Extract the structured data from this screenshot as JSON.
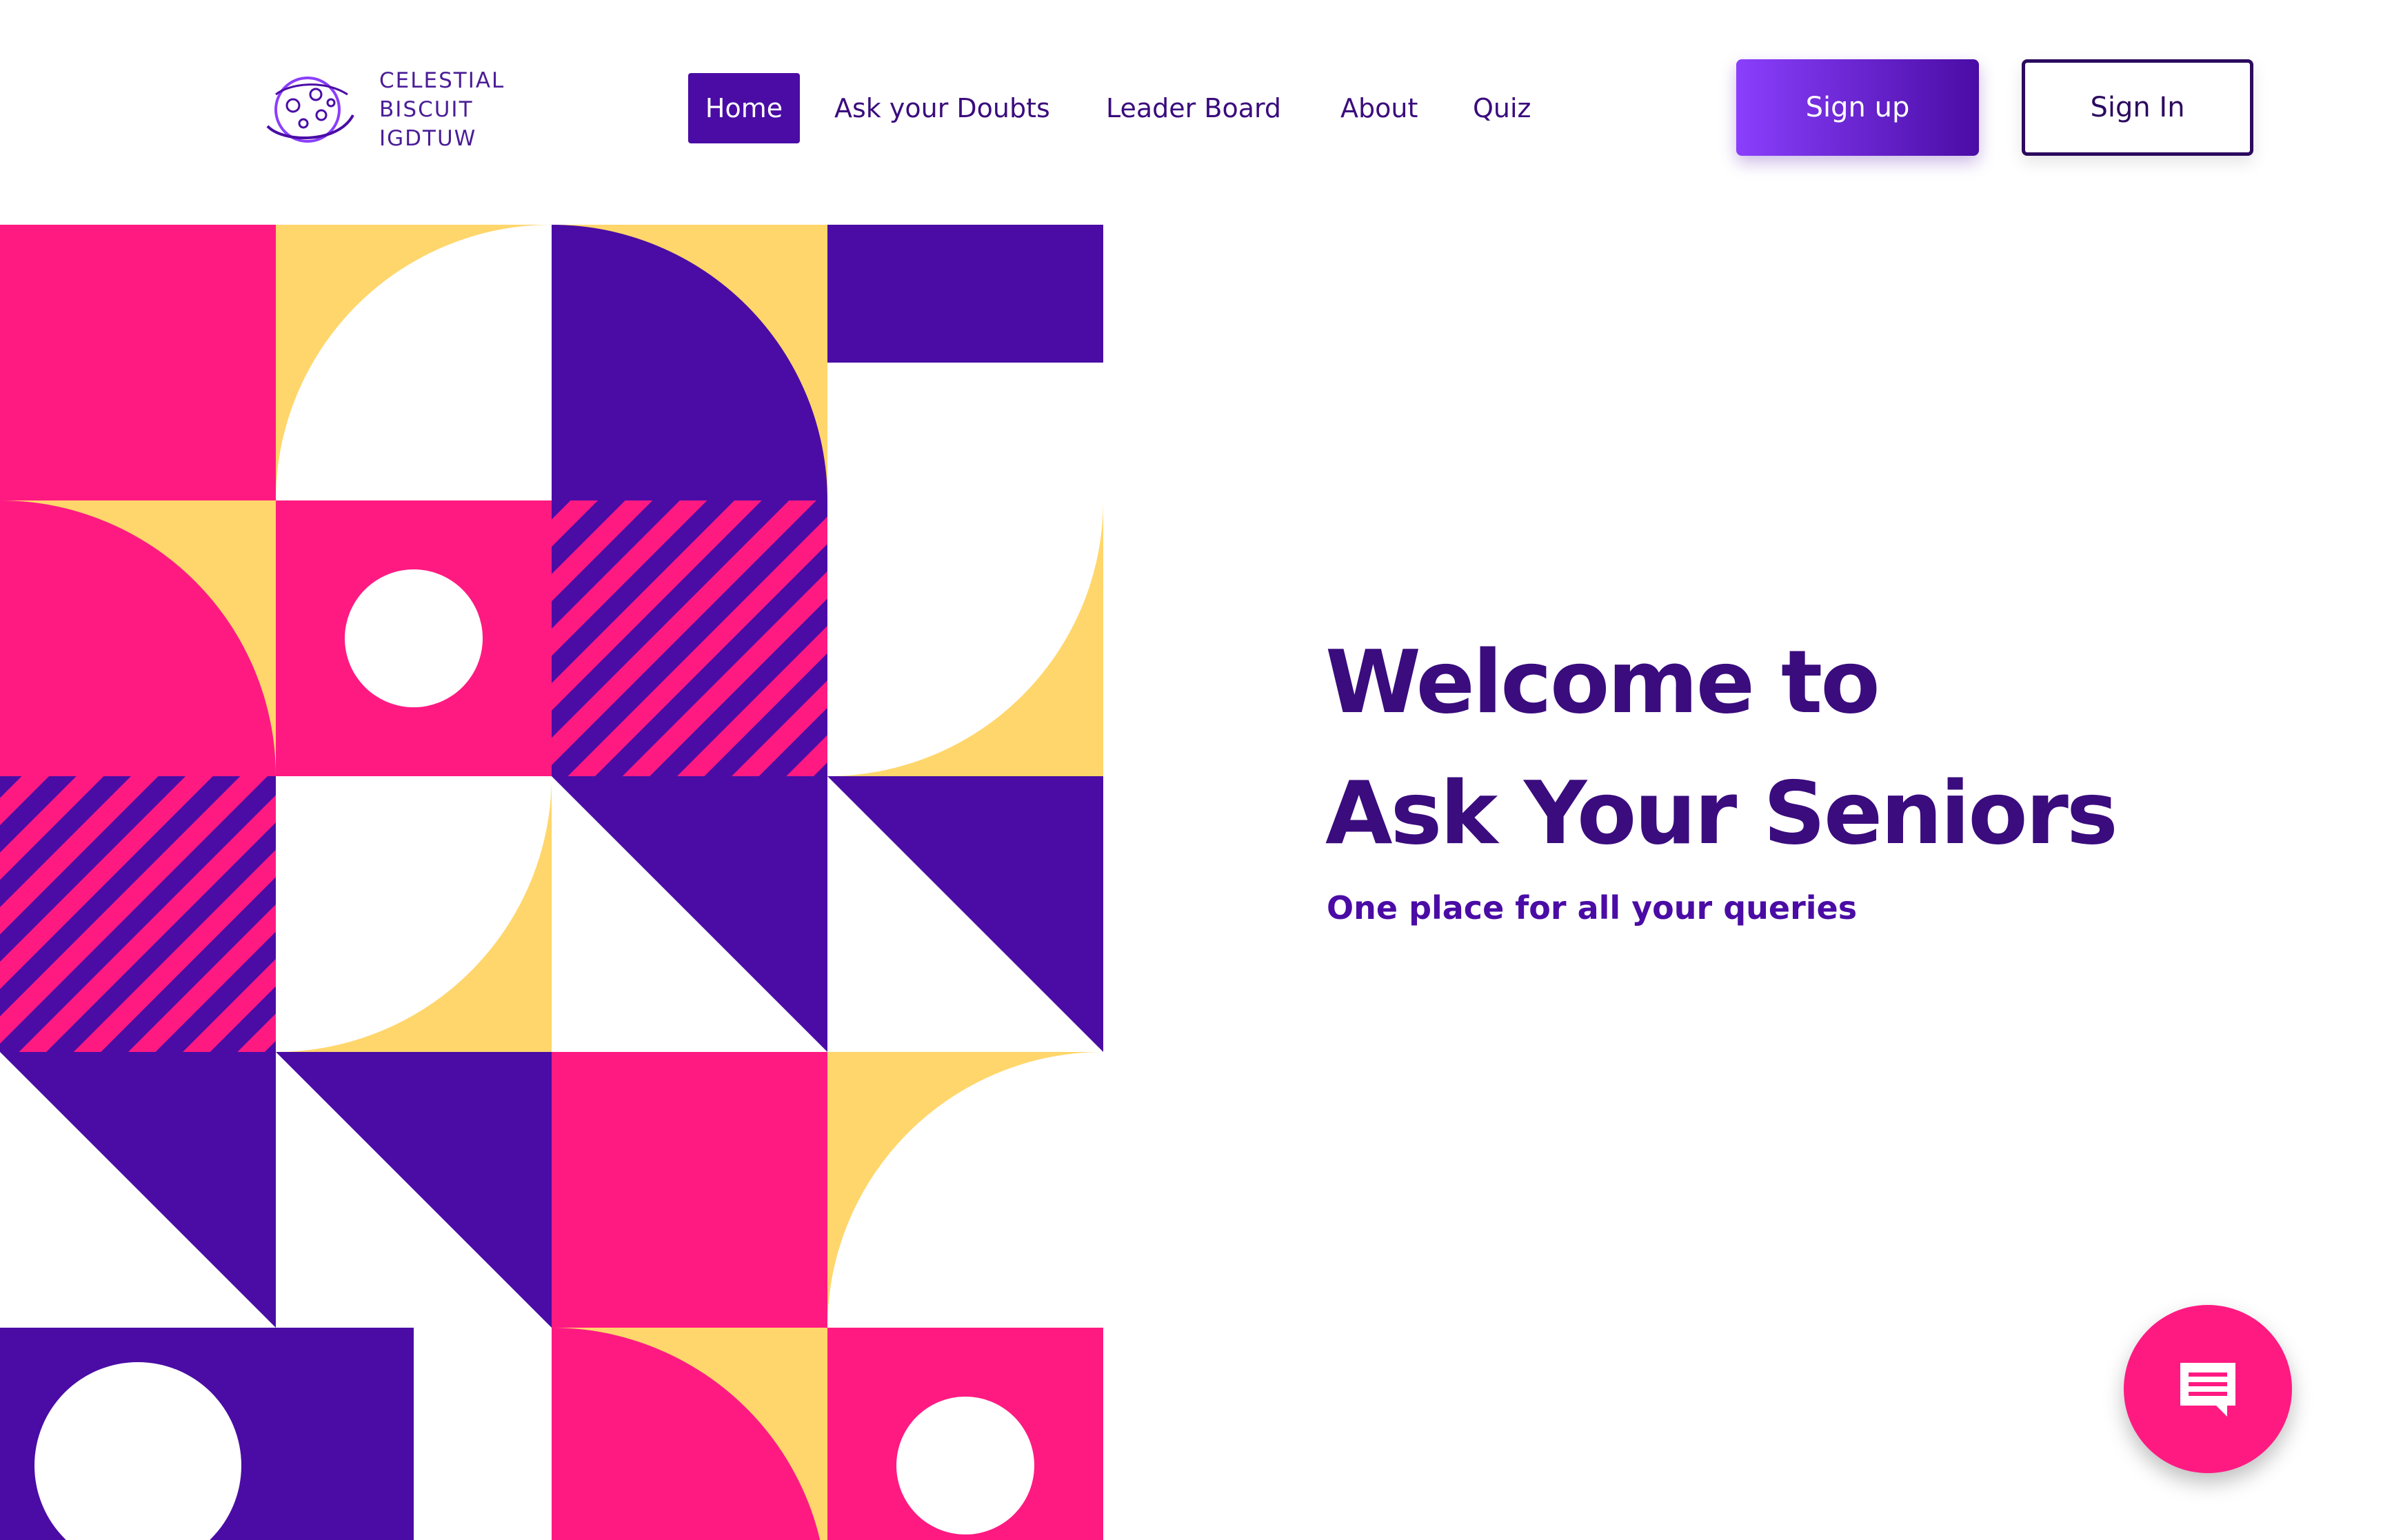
{
  "brand": {
    "logo_lines": [
      "CELESTIAL",
      "BISCUIT",
      "IGDTUW"
    ],
    "logo_icon": "planet-icon"
  },
  "nav": {
    "items": [
      {
        "label": "Home",
        "active": true
      },
      {
        "label": "Ask your Doubts",
        "active": false
      },
      {
        "label": "Leader Board",
        "active": false
      },
      {
        "label": "About",
        "active": false
      },
      {
        "label": "Quiz",
        "active": false
      }
    ]
  },
  "auth": {
    "signup_label": "Sign up",
    "signin_label": "Sign In"
  },
  "hero": {
    "title_line1": "Welcome to",
    "title_line2": "Ask Your Seniors",
    "subtitle": "One place for all your queries"
  },
  "chat": {
    "icon": "chat-bubble-icon"
  },
  "colors": {
    "primary": "#4a0ca5",
    "dark_text": "#3a0c7d",
    "pink": "#ff1a82",
    "yellow": "#ffd66b",
    "purple_light": "#8a3ffc"
  }
}
